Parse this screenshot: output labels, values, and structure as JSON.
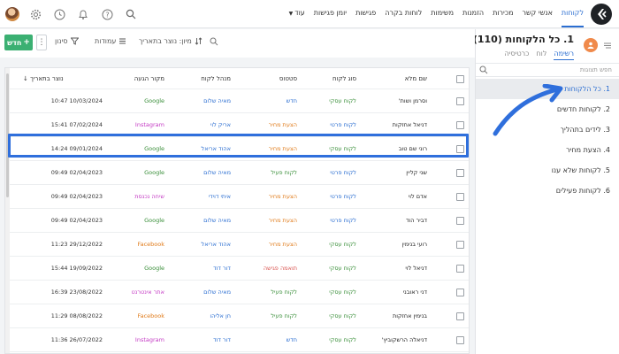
{
  "nav": {
    "items": [
      "לקוחות",
      "אנשי קשר",
      "מכירות",
      "הזמנות",
      "משימות",
      "לוחות בקרה",
      "פגישות",
      "יומן פגישות",
      "עוד"
    ],
    "active_index": 0
  },
  "sidebar": {
    "title": "1. כל הלקוחות (110)",
    "tabs": [
      "רשימה",
      "לוח",
      "כרטיסיה"
    ],
    "search_placeholder": "חפש תצוגות",
    "views": [
      "1. כל הלקוחות",
      "2. לקוחות חדשים",
      "3. לידים בתהליך",
      "4. הצעת מחיר",
      "5. לקוחות שלא ענו",
      "6. לקוחות פעילים"
    ],
    "active_view": 0
  },
  "toolbar": {
    "new_label": "חדש",
    "filter_label": "סינון",
    "columns_label": "עמודות",
    "sort_label": "מיון: נוצר בתאריך"
  },
  "table": {
    "columns": [
      "שם מלא",
      "סוג לקוח",
      "סטטוס",
      "מנהל לקוח",
      "מקור הגעה",
      "↓ נוצר בתאריך"
    ],
    "rows": [
      [
        "וסרמן ושות'",
        "לקוח עסקי",
        "חדש",
        "מאיה שלום",
        "Google",
        "10:47 10/03/2024"
      ],
      [
        "דניאל אחזקות",
        "לקוח פרטי",
        "הצעת מחיר",
        "אריק לוי",
        "Instagram",
        "15:41 07/02/2024"
      ],
      [
        "רוני שם טוב",
        "לקוח עסקי",
        "הצעת מחיר",
        "אהוד אריאל",
        "Google",
        "14:24 09/01/2024"
      ],
      [
        "שני קליין",
        "לקוח פרטי",
        "לקוח פעיל",
        "מאיה שלום",
        "Google",
        "09:49 02/04/2023"
      ],
      [
        "אדם לוי",
        "לקוח פרטי",
        "הצעת מחיר",
        "איתי דוידי",
        "שיחה נכנסת",
        "09:49 02/04/2023"
      ],
      [
        "דביר הוד",
        "לקוח פרטי",
        "הצעת מחיר",
        "מאיה שלום",
        "Google",
        "09:49 02/04/2023"
      ],
      [
        "רועי בנימין",
        "לקוח עסקי",
        "הצעת מחיר",
        "אהוד אריאל",
        "Facebook",
        "11:23 29/12/2022"
      ],
      [
        "דניאל לוי",
        "לקוח עסקי",
        "תואמה פגישה",
        "דור דוד",
        "Google",
        "15:44 19/09/2022"
      ],
      [
        "דני ראובני",
        "לקוח עסקי",
        "לקוח פעיל",
        "מאיה שלום",
        "אתר אינטרנט",
        "16:39 23/08/2022"
      ],
      [
        "בנימין אחזקות",
        "לקוח עסקי",
        "לקוח פעיל",
        "חן אליהו",
        "Facebook",
        "11:29 08/08/2022"
      ],
      [
        "דניאלה הרשקוביץ'",
        "לקוח עסקי",
        "חדש",
        "דור דוד",
        "Instagram",
        "11:36 26/07/2022"
      ]
    ],
    "highlighted_row": 2
  },
  "colors": {
    "accent": "#2b6ed1",
    "new_button": "#3bb072",
    "type_business": "#3a8f3a",
    "type_private": "#2b6ed1",
    "status_new": "#2b6ed1",
    "status_quote": "#e07b1a",
    "status_active": "#3a8f3a",
    "status_meeting": "#d9534f",
    "source_google": "#3a8f3a",
    "source_instagram": "#c43bc4",
    "source_facebook": "#e07b1a",
    "source_call": "#c43bc4",
    "source_website": "#c43bc4",
    "manager": "#2b6ed1",
    "highlight_border": "#2f6fdc"
  },
  "icons": {
    "logo": "brand-logo-icon",
    "top": [
      "avatar",
      "gear-icon",
      "clock-icon",
      "bell-icon",
      "help-icon",
      "search-icon"
    ]
  }
}
